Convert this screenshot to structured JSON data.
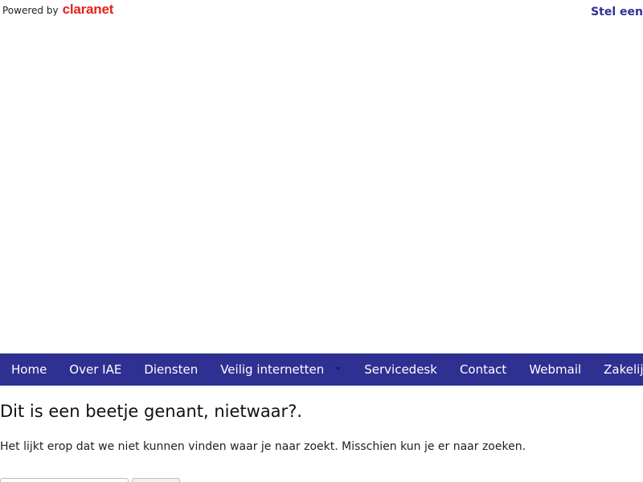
{
  "topbar": {
    "powered_by": "Powered by",
    "brand": "claranet",
    "cta": "Stel een"
  },
  "nav": {
    "items": [
      {
        "label": "Home"
      },
      {
        "label": "Over IAE"
      },
      {
        "label": "Diensten"
      },
      {
        "label": "Veilig internetten",
        "has_dropdown": true
      },
      {
        "label": "Servicedesk"
      },
      {
        "label": "Contact"
      },
      {
        "label": "Webmail"
      },
      {
        "label": "Zakelijk"
      }
    ]
  },
  "content": {
    "heading": "Dit is een beetje genant, nietwaar?.",
    "message": "Het lijkt erop dat we niet kunnen vinden waar je naar zoekt. Misschien kun je er naar zoeken."
  },
  "search": {
    "value": "",
    "button_label": ""
  },
  "colors": {
    "nav_background": "#2e3192",
    "brand_red": "#e2231a",
    "link_blue": "#2e3192"
  }
}
